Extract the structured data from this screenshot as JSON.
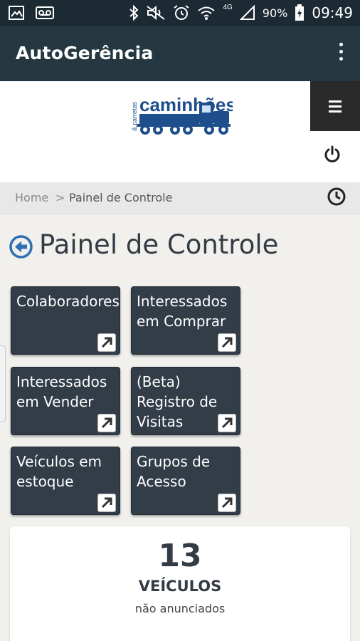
{
  "status_bar": {
    "battery": "90%",
    "network": "4G",
    "time": "09:49",
    "icons": [
      "gallery-icon",
      "voicemail-icon",
      "bluetooth-icon",
      "mute-icon",
      "alarm-icon",
      "wifi-icon",
      "signal-icon",
      "battery-charging-icon"
    ]
  },
  "app_bar": {
    "title": "AutoGerência",
    "menu_icon": "overflow-menu-icon"
  },
  "header": {
    "logo_icon": "truck-logo",
    "logo_text_main": "caminhões",
    "logo_text_side": "& carretas",
    "menu_icon": "hamburger-icon",
    "power_icon": "power-icon"
  },
  "breadcrumb": {
    "home": "Home",
    "separator": ">",
    "current": "Painel de Controle",
    "history_icon": "clock-icon"
  },
  "page": {
    "title": "Painel de Controle",
    "back_icon": "back-arrow-icon"
  },
  "tiles": [
    {
      "label": "Colaboradores"
    },
    {
      "label": "Interessados em Comprar"
    },
    {
      "label": "Interessados em Vender"
    },
    {
      "label": "(Beta) Registro de Visitas"
    },
    {
      "label": "Veículos em estoque"
    },
    {
      "label": "Grupos de Acesso"
    }
  ],
  "stats": {
    "number": "13",
    "label": "VEÍCULOS",
    "sub": "não anunciados"
  },
  "colors": {
    "status_bar": "#1c2a33",
    "app_bar": "#253842",
    "tile": "#323d48",
    "accent_blue": "#2f6fb3",
    "background": "#f1f0ed"
  }
}
